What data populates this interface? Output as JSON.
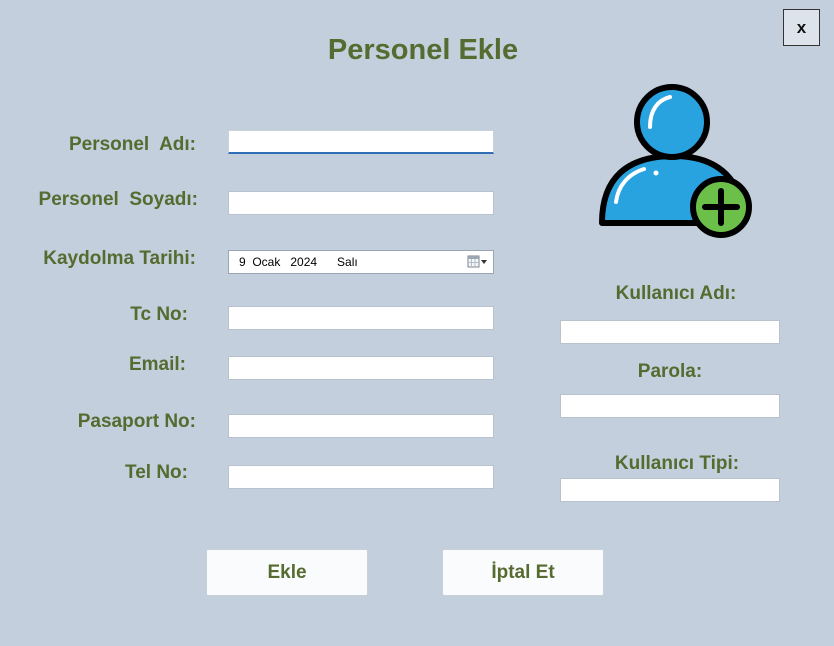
{
  "window": {
    "title": "Personel Ekle",
    "close_label": "x"
  },
  "form": {
    "first_name_label": "Personel  Adı:",
    "last_name_label": "Personel  Soyadı:",
    "register_date_label": "Kaydolma Tarihi:",
    "register_date_value": "9  Ocak   2024      Salı",
    "tc_label": "Tc No:",
    "email_label": "Email:",
    "passport_label": "Pasaport No:",
    "phone_label": "Tel No:",
    "first_name_value": "",
    "last_name_value": "",
    "tc_value": "",
    "email_value": "",
    "passport_value": "",
    "phone_value": ""
  },
  "account": {
    "username_label": "Kullanıcı Adı:",
    "password_label": "Parola:",
    "user_type_label": "Kullanıcı Tipi:",
    "username_value": "",
    "password_value": "",
    "user_type_value": ""
  },
  "actions": {
    "add_label": "Ekle",
    "cancel_label": "İptal Et"
  },
  "icons": {
    "add_user": "add-user-icon",
    "calendar": "calendar-dropdown-icon"
  },
  "colors": {
    "background": "#c3cfdd",
    "label": "#556b2f",
    "icon_blue": "#29a3e0",
    "icon_green": "#6cc04a",
    "focus_underline": "#2f6fb8"
  }
}
